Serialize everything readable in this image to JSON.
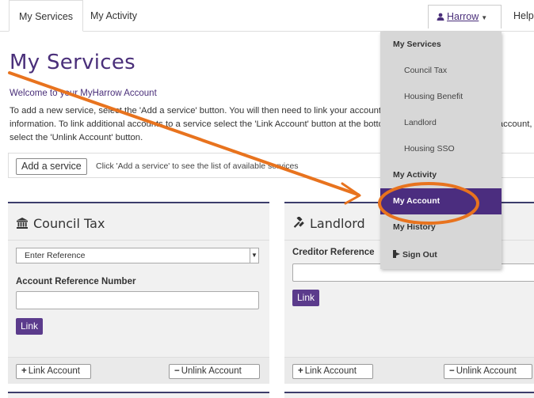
{
  "tabs": [
    {
      "label": "My Services",
      "active": true
    },
    {
      "label": "My Activity",
      "active": false
    }
  ],
  "user_menu": {
    "name": "Harrow",
    "help_label": "Help"
  },
  "page": {
    "title": "My Services",
    "welcome": "Welcome to your MyHarrow Account",
    "intro": "To add a new service, select the 'Add a service' button. You will then need to link your account by providing some account information. To link additional accounts to a service select the 'Link Account' button at the bottom of each tile. To remove an account, select the 'Unlink Account' button."
  },
  "add_service": {
    "button_label": "Add a service",
    "hint": "Click 'Add a service' to see the list of available services"
  },
  "tiles": [
    {
      "title": "Council Tax",
      "icon": "bank-icon",
      "select_value": "Enter Reference",
      "field_label": "Account Reference Number",
      "input_value": "",
      "link_label": "Link",
      "link_account_label": "Link Account",
      "unlink_account_label": "Unlink Account"
    },
    {
      "title": "Landlord",
      "icon": "gavel-icon",
      "field_label": "Creditor Reference",
      "input_value": "",
      "link_label": "Link",
      "link_account_label": "Link Account",
      "unlink_account_label": "Unlink Account"
    }
  ],
  "dropdown": {
    "items": [
      {
        "label": "My Services",
        "kind": "header"
      },
      {
        "label": "Council Tax",
        "kind": "sub"
      },
      {
        "label": "Housing Benefit",
        "kind": "sub"
      },
      {
        "label": "Landlord",
        "kind": "sub"
      },
      {
        "label": "Housing SSO",
        "kind": "sub"
      },
      {
        "label": "My Activity",
        "kind": "header"
      },
      {
        "label": "My Account",
        "kind": "active"
      },
      {
        "label": "My History",
        "kind": "header"
      },
      {
        "label": "Sign Out",
        "kind": "signout"
      }
    ]
  },
  "colors": {
    "brand_purple": "#4a2f7a",
    "menu_active": "#4b2d7f",
    "annotation_orange": "#e8731e",
    "tile_bg": "#f1f1f1"
  }
}
